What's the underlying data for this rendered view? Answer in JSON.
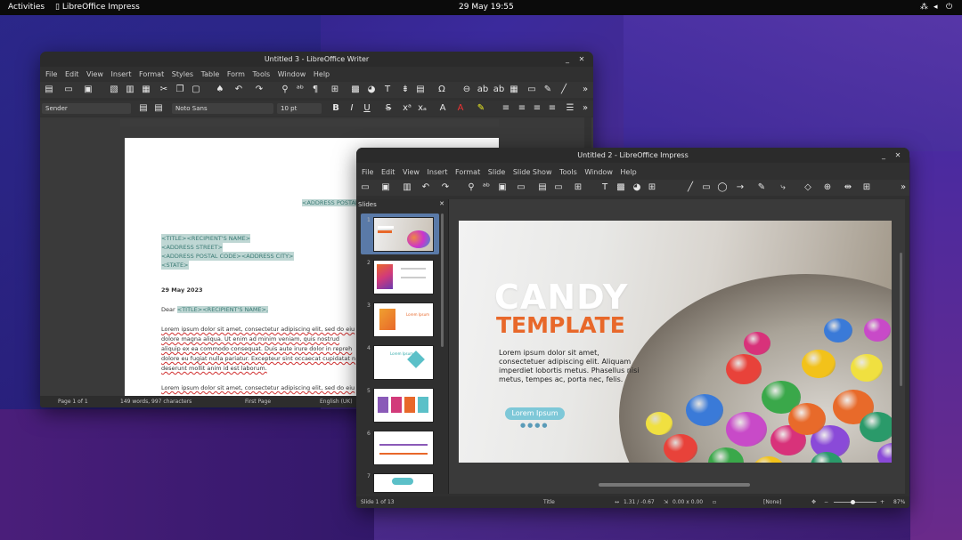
{
  "topbar": {
    "activities": "Activities",
    "app": "LibreOffice Impress",
    "clock": "29 May  19:55"
  },
  "writer": {
    "title": "Untitled 3 - LibreOffice Writer",
    "menu": [
      "File",
      "Edit",
      "View",
      "Insert",
      "Format",
      "Styles",
      "Table",
      "Form",
      "Tools",
      "Window",
      "Help"
    ],
    "style": "Sender",
    "font": "Noto Sans",
    "size": "10 pt",
    "doc": {
      "address_top": "<ADDRESS POSTAL CO",
      "recipient_lines": [
        "<TITLE><RECIPIENT'S NAME>",
        "<ADDRESS STREET>",
        "<ADDRESS POSTAL CODE><ADDRESS CITY>",
        "<STATE>"
      ],
      "date": "29 May 2023",
      "dear": "Dear",
      "dear_field": "<TITLE><RECIPIENT'S NAME>,",
      "para1": [
        "Lorem ipsum dolor sit amet, consectetur adipiscing elit, sed do eiu",
        "dolore magna aliqua. Ut enim ad minim veniam, quis nostrud",
        "aliquip ex ea commodo consequat. Duis aute irure dolor in repreh",
        "dolore eu fugiat nulla pariatur. Excepteur sint occaecat cupidatat n",
        "deserunt mollit anim id est laborum."
      ],
      "para2": "Lorem ipsum dolor sit amet, consectetur adipiscing elit, sed do eiu"
    },
    "status": {
      "page": "Page 1 of 1",
      "words": "149 words, 997 characters",
      "page_style": "First Page",
      "language": "English (UK)"
    }
  },
  "impress": {
    "title": "Untitled 2 - LibreOffice Impress",
    "menu": [
      "File",
      "Edit",
      "View",
      "Insert",
      "Format",
      "Slide",
      "Slide Show",
      "Tools",
      "Window",
      "Help"
    ],
    "slides_pane": {
      "title": "Slides",
      "numbers": [
        "1",
        "2",
        "3",
        "4",
        "5",
        "6",
        "7"
      ],
      "thumb3_text": "Lorem Ipsum",
      "thumb4_text": "Lorem Ipsum"
    },
    "slide": {
      "title1": "CANDY",
      "title2": "TEMPLATE",
      "body": [
        "Lorem ipsum dolor sit amet,",
        "consectetuer adipiscing elit. Aliquam",
        "imperdiet lobortis metus. Phasellus nisi",
        "metus, tempes ac, porta nec, felis."
      ],
      "button": "Lorem Ipsum"
    },
    "status": {
      "slide": "Slide 1 of 13",
      "layout": "Title",
      "pos": "1.31 / -0.67",
      "size": "0.00 x 0.00",
      "master": "[None]",
      "zoom": "87%"
    }
  },
  "colors": {
    "accent_orange": "#e8682a",
    "slide_title_white": "#ffffff",
    "pill": "#7ec8d8"
  }
}
